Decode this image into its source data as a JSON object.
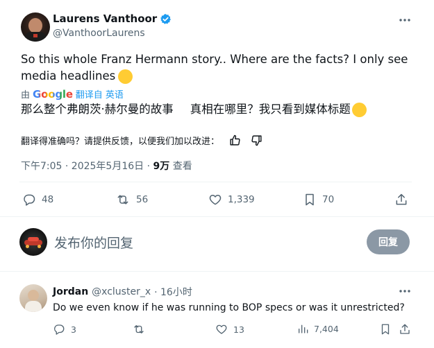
{
  "author": {
    "name": "Laurens Vanthoor",
    "handle": "@VanthoorLaurens",
    "verified": true
  },
  "tweet": {
    "text_line1": "So this whole Franz Hermann story.. Where are the facts? I only see",
    "text_line2": "media headlines",
    "emoji": "😶",
    "translated_by_prefix": "由",
    "translated_by_brand": "Google",
    "translated_by_suffix": "翻译自 英语",
    "translation_part1": "那么整个弗朗茨·赫尔曼的故事",
    "translation_part2": "真相在哪里？我只看到媒体标题",
    "feedback_prompt": "翻译得准确吗？请提供反馈，以便我们加以改进：",
    "meta_time": "下午7:05 · 2025年5月16日 · ",
    "meta_views_number": "9万",
    "meta_views_label": " 查看"
  },
  "actions": {
    "replies": "48",
    "retweets": "56",
    "likes": "1,339",
    "bookmarks": "70"
  },
  "composer": {
    "placeholder": "发布你的回复",
    "button_label": "回复"
  },
  "reply": {
    "name": "Jordan",
    "handle": "@xcluster_x",
    "time": "· 16小时",
    "text": "Do we even know if he was running to BOP specs or was it unrestricted?",
    "replies": "3",
    "likes": "13",
    "views": "7,404"
  },
  "colors": {
    "verified_blue": "#1d9bf0",
    "link_blue": "#1d9bf0",
    "muted_gray": "#536471",
    "reply_button": "#8b98a5"
  }
}
